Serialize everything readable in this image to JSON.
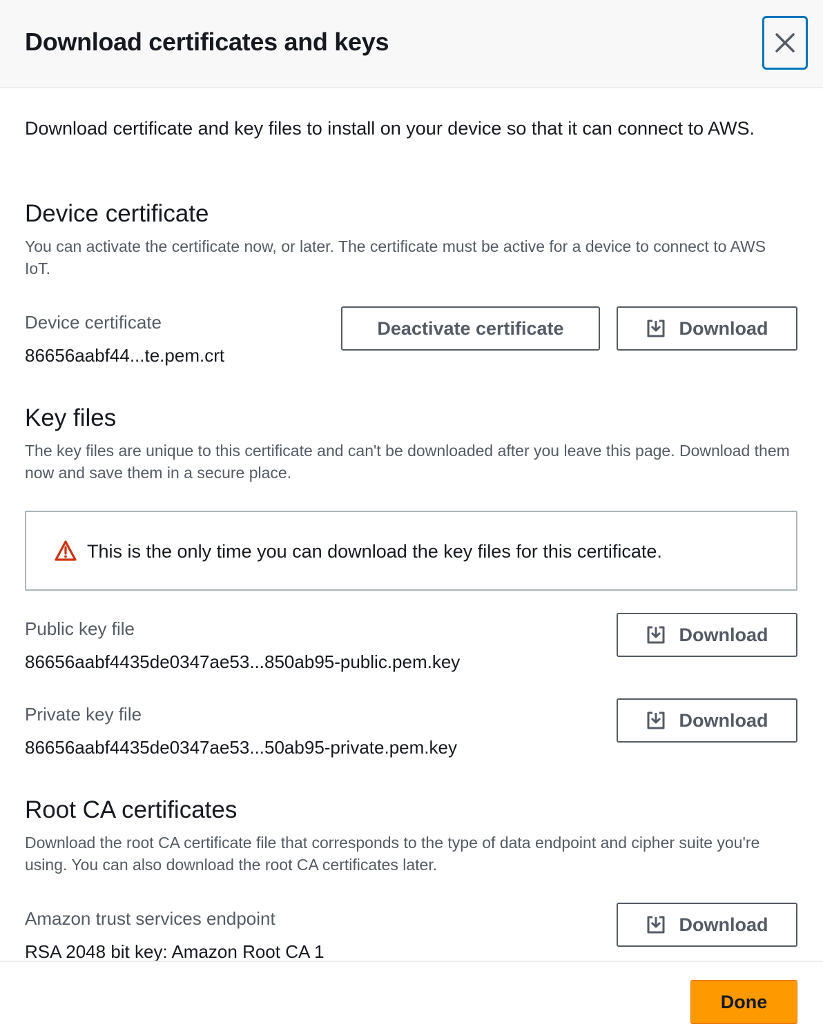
{
  "modal": {
    "title": "Download certificates and keys",
    "close_icon": "close-icon",
    "intro": "Download certificate and key files to install on your device so that it can connect to AWS."
  },
  "device_certificate": {
    "section_title": "Device certificate",
    "section_desc": "You can activate the certificate now, or later. The certificate must be active for a device to connect to AWS IoT.",
    "label": "Device certificate",
    "value": "86656aabf44...te.pem.crt",
    "deactivate_label": "Deactivate certificate",
    "download_label": "Download"
  },
  "key_files": {
    "section_title": "Key files",
    "section_desc": "The key files are unique to this certificate and can't be downloaded after you leave this page. Download them now and save them in a secure place.",
    "alert_text": "This is the only time you can download the key files for this certificate.",
    "public": {
      "label": "Public key file",
      "value": "86656aabf4435de0347ae53...850ab95-public.pem.key",
      "download_label": "Download"
    },
    "private": {
      "label": "Private key file",
      "value": "86656aabf4435de0347ae53...50ab95-private.pem.key",
      "download_label": "Download"
    }
  },
  "root_ca": {
    "section_title": "Root CA certificates",
    "section_desc": "Download the root CA certificate file that corresponds to the type of data endpoint and cipher suite you're using. You can also download the root CA certificates later.",
    "label": "Amazon trust services endpoint",
    "value": "RSA 2048 bit key: Amazon Root CA 1",
    "download_label": "Download"
  },
  "footer": {
    "done_label": "Done"
  },
  "colors": {
    "accent_orange": "#ff9900",
    "focus_blue": "#0073bb",
    "warning_red": "#d13212"
  }
}
